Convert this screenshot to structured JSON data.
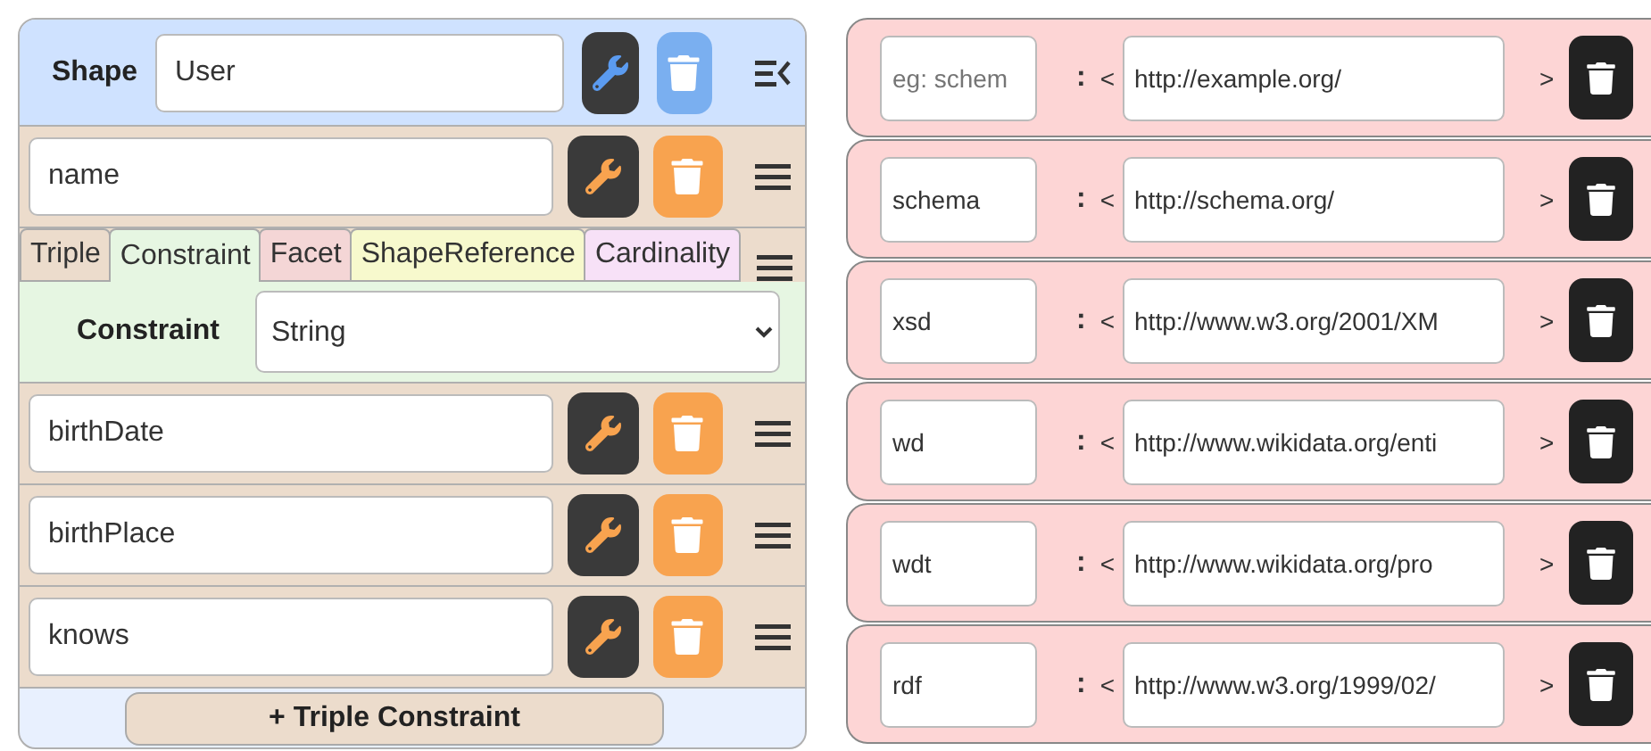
{
  "shape": {
    "label": "Shape",
    "value": "User"
  },
  "triples": [
    {
      "value": "name",
      "expanded": true
    },
    {
      "value": "birthDate",
      "expanded": false
    },
    {
      "value": "birthPlace",
      "expanded": false
    },
    {
      "value": "knows",
      "expanded": false
    }
  ],
  "tabs": [
    {
      "label": "Triple",
      "selected": false,
      "color": "#ecdccc"
    },
    {
      "label": "Constraint",
      "selected": true,
      "color": "#e6f6e2"
    },
    {
      "label": "Facet",
      "selected": false,
      "color": "#f4d6d6"
    },
    {
      "label": "ShapeReference",
      "selected": false,
      "color": "#f7f9cd"
    },
    {
      "label": "Cardinality",
      "selected": false,
      "color": "#f7e1f7"
    }
  ],
  "constraint": {
    "label": "Constraint",
    "value": "String"
  },
  "add_button": "+ Triple Constraint",
  "prefixes": [
    {
      "placeholder": "eg: schem",
      "colon": ":",
      "open": "<",
      "iri": "http://example.org/",
      "close": ">"
    },
    {
      "value": "schema",
      "colon": ":",
      "open": "<",
      "iri": "http://schema.org/",
      "close": ">"
    },
    {
      "value": "xsd",
      "colon": ":",
      "open": "<",
      "iri": "http://www.w3.org/2001/XM",
      "close": ">"
    },
    {
      "value": "wd",
      "colon": ":",
      "open": "<",
      "iri": "http://www.wikidata.org/enti",
      "close": ">"
    },
    {
      "value": "wdt",
      "colon": ":",
      "open": "<",
      "iri": "http://www.wikidata.org/pro",
      "close": ">"
    },
    {
      "value": "rdf",
      "colon": ":",
      "open": "<",
      "iri": "http://www.w3.org/1999/02/",
      "close": ">"
    }
  ]
}
